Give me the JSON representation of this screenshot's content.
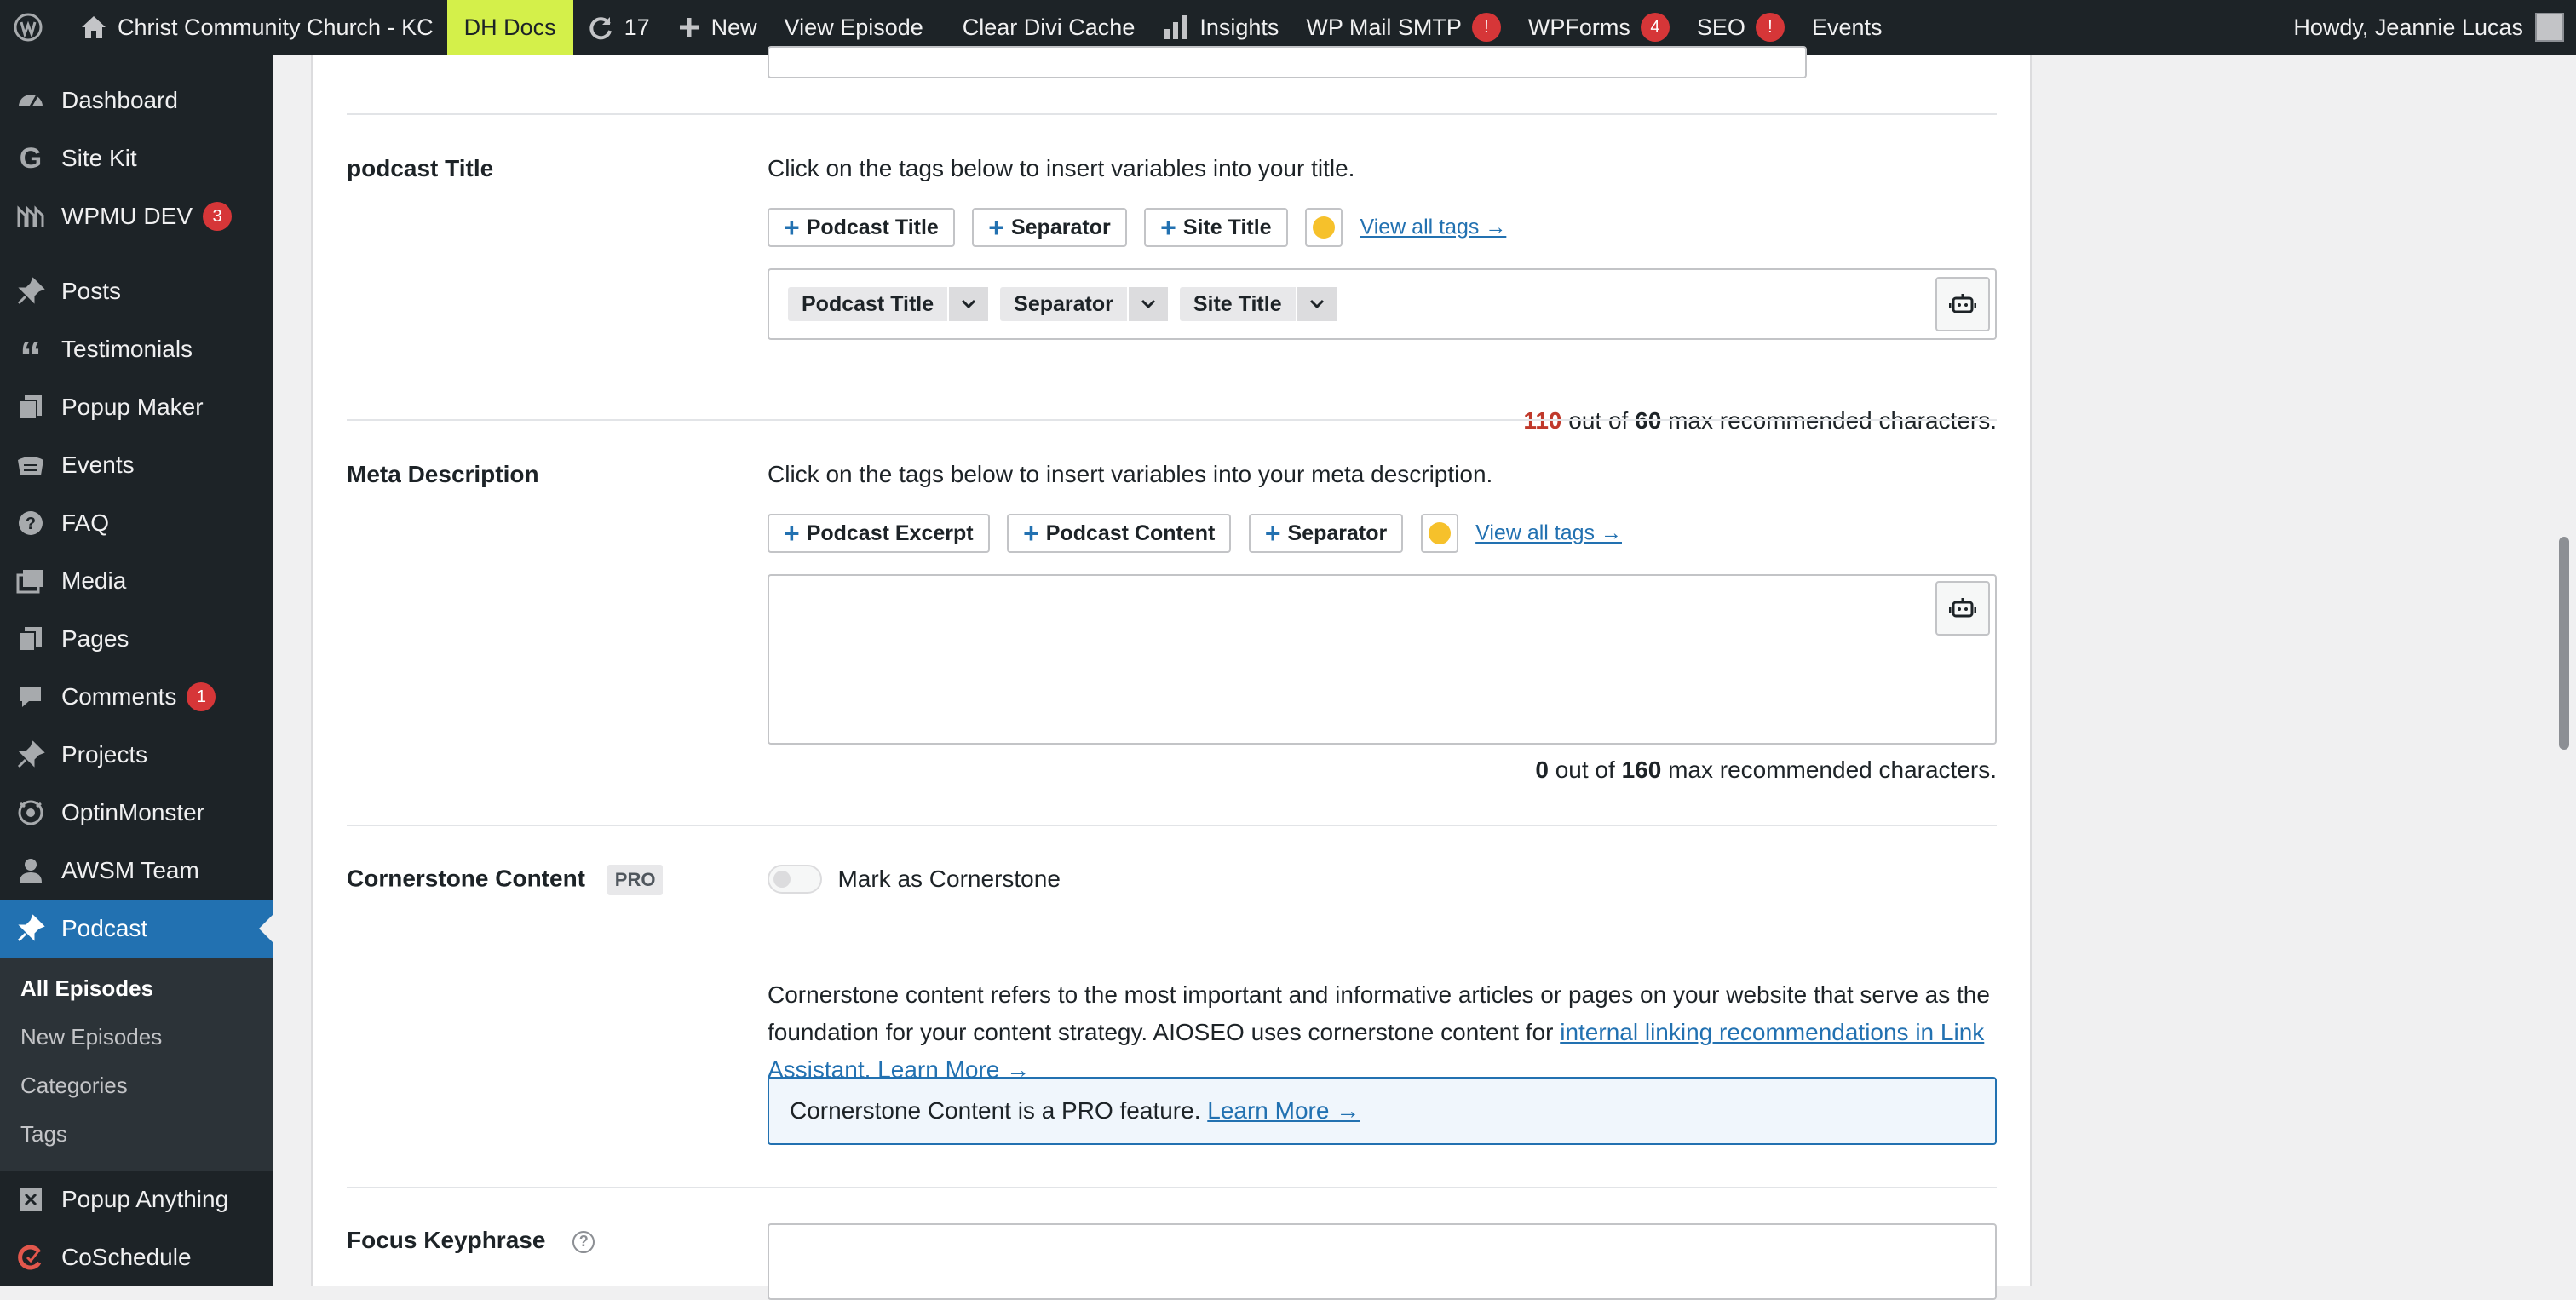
{
  "adminbar": {
    "site_name": "Christ Community Church - KC",
    "dh_docs": "DH Docs",
    "updates_count": "17",
    "new_label": "New",
    "view_episode": "View Episode",
    "clear_cache": "Clear Divi Cache",
    "insights": "Insights",
    "wp_mail_smtp": "WP Mail SMTP",
    "wp_mail_badge": "!",
    "wpforms": "WPForms",
    "wpforms_badge": "4",
    "seo": "SEO",
    "seo_badge": "!",
    "events": "Events",
    "howdy": "Howdy, Jeannie Lucas"
  },
  "sidebar": {
    "items": [
      {
        "label": "Dashboard",
        "icon": "dashboard-icon"
      },
      {
        "label": "Site Kit",
        "icon": "google-icon"
      },
      {
        "label": "WPMU DEV",
        "icon": "wpmudev-icon",
        "badge": "3"
      },
      {
        "label": "Posts",
        "icon": "pin-icon"
      },
      {
        "label": "Testimonials",
        "icon": "quote-icon"
      },
      {
        "label": "Popup Maker",
        "icon": "popup-icon"
      },
      {
        "label": "Events",
        "icon": "calendar-icon"
      },
      {
        "label": "FAQ",
        "icon": "question-icon"
      },
      {
        "label": "Media",
        "icon": "media-icon"
      },
      {
        "label": "Pages",
        "icon": "pages-icon"
      },
      {
        "label": "Comments",
        "icon": "comment-icon",
        "badge": "1"
      },
      {
        "label": "Projects",
        "icon": "pin-icon"
      },
      {
        "label": "OptinMonster",
        "icon": "optinmonster-icon"
      },
      {
        "label": "AWSM Team",
        "icon": "user-icon"
      },
      {
        "label": "Podcast",
        "icon": "pin-icon"
      }
    ],
    "submenu": [
      "All Episodes",
      "New Episodes",
      "Categories",
      "Tags"
    ],
    "after": [
      {
        "label": "Popup Anything",
        "icon": "popup-anything-icon"
      },
      {
        "label": "CoSchedule",
        "icon": "coschedule-icon"
      }
    ]
  },
  "title_section": {
    "label": "podcast Title",
    "description": "Click on the tags below to insert variables into your title.",
    "tags": [
      "Podcast Title",
      "Separator",
      "Site Title"
    ],
    "view_all": "View all tags →",
    "chips": [
      "Podcast Title",
      "Separator",
      "Site Title"
    ],
    "count_value": "110",
    "count_text": "out of",
    "count_max": "60",
    "count_suffix": "max recommended characters."
  },
  "meta_section": {
    "label": "Meta Description",
    "description": "Click on the tags below to insert variables into your meta description.",
    "tags": [
      "Podcast Excerpt",
      "Podcast Content",
      "Separator"
    ],
    "view_all": "View all tags →",
    "count_value": "0",
    "count_text": "out of",
    "count_max": "160",
    "count_suffix": "max recommended characters."
  },
  "cornerstone": {
    "label": "Cornerstone Content",
    "badge": "PRO",
    "toggle_label": "Mark as Cornerstone",
    "para_1": "Cornerstone content refers to the most important and informative articles or pages on your website that serve as the foundation for your content strategy. AIOSEO uses cornerstone content for ",
    "para_link": "internal linking recommendations in Link Assistant.",
    "learn_more": "Learn More →",
    "notice_text": "Cornerstone Content is a PRO feature.",
    "notice_link": "Learn More →"
  },
  "focus": {
    "label": "Focus Keyphrase"
  },
  "colors": {
    "adminbar_bg": "#1d2327",
    "accent": "#2271b1",
    "highlight": "#d4f04a",
    "badge_red": "#d63638"
  }
}
